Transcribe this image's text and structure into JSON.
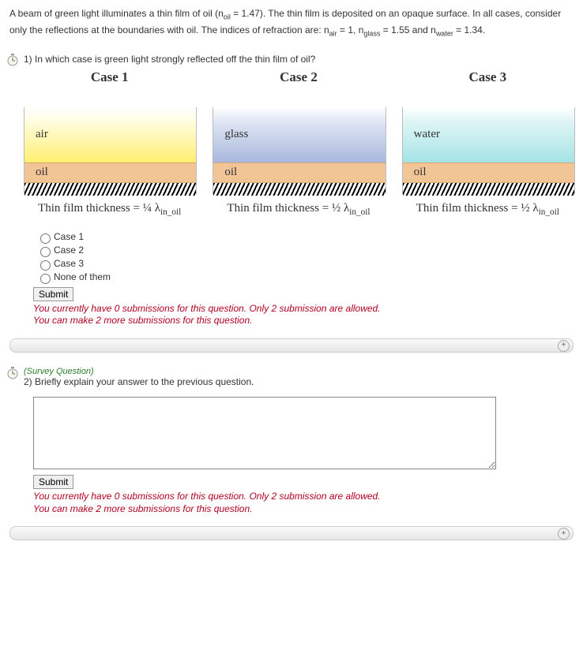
{
  "intro": {
    "line1a": "A beam of green light illuminates a thin film of oil (n",
    "line1b": " = 1.47).  The thin film is deposited on an opaque surface. In all cases, consider only the reflections at the boundaries with oil. The indices of refraction are: n",
    "line1c": " = 1, n",
    "line1d": " = 1.55 and n",
    "line1e": " = 1.34.",
    "sub_oil": "oil",
    "sub_air": "air",
    "sub_glass": "glass",
    "sub_water": "water"
  },
  "q1": {
    "text": "1)  In which case is green light strongly reflected off the thin film of oil?",
    "cases": {
      "c1": {
        "title": "Case 1",
        "top": "air",
        "oil": "oil",
        "thickness_prefix": "Thin film thickness = ¼ λ",
        "thickness_sub": "in_oil"
      },
      "c2": {
        "title": "Case 2",
        "top": "glass",
        "oil": "oil",
        "thickness_prefix": "Thin film thickness = ½ λ",
        "thickness_sub": "in_oil"
      },
      "c3": {
        "title": "Case 3",
        "top": "water",
        "oil": "oil",
        "thickness_prefix": "Thin film thickness = ½ λ",
        "thickness_sub": "in_oil"
      }
    },
    "options": {
      "o1": "Case 1",
      "o2": "Case 2",
      "o3": "Case 3",
      "o4": "None of them"
    },
    "submit": "Submit",
    "feedback1": "You currently have 0 submissions for this question. Only 2 submission are allowed.",
    "feedback2": "You can make 2 more submissions for this question."
  },
  "q2": {
    "survey": "(Survey Question)",
    "text": "2) Briefly explain your answer to the previous question.",
    "submit": "Submit",
    "feedback1": "You currently have 0 submissions for this question. Only 2 submission are allowed.",
    "feedback2": "You can make 2 more submissions for this question."
  }
}
